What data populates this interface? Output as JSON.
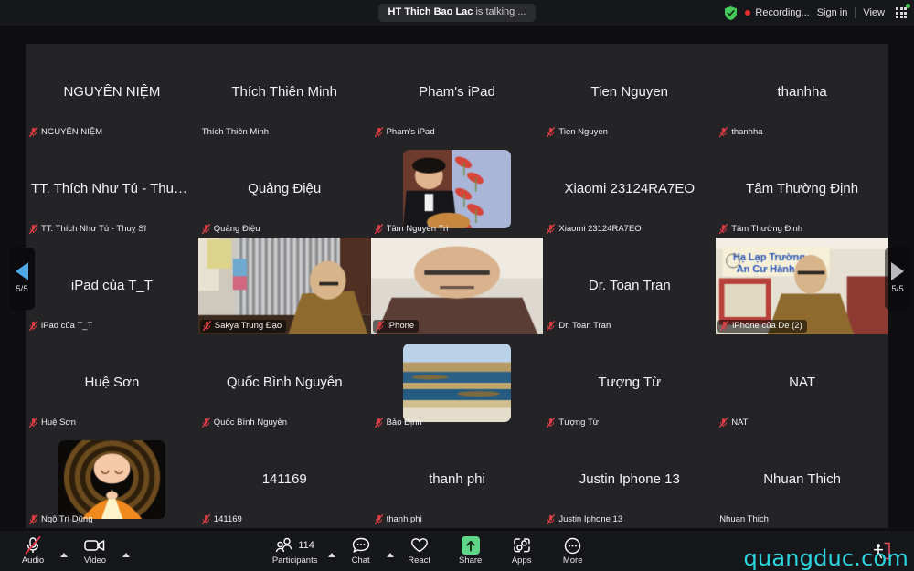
{
  "topbar": {
    "talking_name": "HT Thich Bao Lac",
    "talking_suffix": " is talking ...",
    "shield_icon": "shield-check-icon",
    "recording_label": "Recording...",
    "signin_label": "Sign in",
    "view_label": "View",
    "view_icon": "grid-view-icon",
    "status_dot_color": "#46c95a",
    "recording_dot_color": "#ea2f2f"
  },
  "pagination": {
    "prev_icon": "chevron-left-icon",
    "next_icon": "chevron-right-icon",
    "prev_label": "5/5",
    "next_label": "5/5",
    "prev_color": "#4ea8e8",
    "next_color": "#b9b9bb"
  },
  "gallery": {
    "columns": 5,
    "rows": 5,
    "tiles": [
      {
        "display_name": "NGUYÊN NIỆM",
        "name_label": "NGUYÊN NIỆM",
        "muted": true,
        "video": "none",
        "show_display_name": true
      },
      {
        "display_name": "Thích Thiên Minh",
        "name_label": "Thích Thiên Minh",
        "muted": false,
        "video": "none",
        "show_display_name": true
      },
      {
        "display_name": "Pham's iPad",
        "name_label": "Pham's iPad",
        "muted": true,
        "video": "none",
        "show_display_name": true
      },
      {
        "display_name": "Tien Nguyen",
        "name_label": "Tien Nguyen",
        "muted": true,
        "video": "none",
        "show_display_name": true
      },
      {
        "display_name": "thanhha",
        "name_label": "thanhha",
        "muted": true,
        "video": "none",
        "show_display_name": true
      },
      {
        "display_name": "TT. Thích Như Tú - Thuỵ Sĩ",
        "name_label": "TT. Thích Như Tú - Thuỵ Sĩ",
        "muted": true,
        "video": "none",
        "show_display_name": true
      },
      {
        "display_name": "Quảng Điệu",
        "name_label": "Quảng Điệu",
        "muted": true,
        "video": "none",
        "show_display_name": true
      },
      {
        "display_name": "Tâm Nguyên Trí",
        "name_label": "Tâm Nguyên Trí",
        "muted": true,
        "video": "avatar-man-guitar",
        "show_display_name": false
      },
      {
        "display_name": "Xiaomi 23124RA7EO",
        "name_label": "Xiaomi 23124RA7EO",
        "muted": true,
        "video": "none",
        "show_display_name": true
      },
      {
        "display_name": "Tâm Thường Định",
        "name_label": "Tâm Thường Định",
        "muted": true,
        "video": "none",
        "show_display_name": true
      },
      {
        "display_name": "iPad của T_T",
        "name_label": "iPad của T_T",
        "muted": true,
        "video": "none",
        "show_display_name": true
      },
      {
        "display_name": "Sakya Trung Đạo",
        "name_label": "Sakya Trung Đạo",
        "muted": true,
        "video": "full-room-curtain",
        "show_display_name": false
      },
      {
        "display_name": "iPhone",
        "name_label": "iPhone",
        "muted": true,
        "video": "full-monk-portrait",
        "show_display_name": false
      },
      {
        "display_name": "Dr. Toan Tran",
        "name_label": "Dr. Toan Tran",
        "muted": true,
        "video": "none",
        "show_display_name": true
      },
      {
        "display_name": "iPhone của De (2)",
        "name_label": "iPhone của De (2)",
        "muted": true,
        "video": "full-monk-banner",
        "show_display_name": false
      },
      {
        "display_name": "Huệ Sơn",
        "name_label": "Huệ Sơn",
        "muted": true,
        "video": "none",
        "show_display_name": true
      },
      {
        "display_name": "Quốc Bình Nguyễn",
        "name_label": "Quốc Bình Nguyễn",
        "muted": true,
        "video": "none",
        "show_display_name": true
      },
      {
        "display_name": "Bảo Định",
        "name_label": "Bảo Định",
        "muted": true,
        "video": "avatar-landscape",
        "show_display_name": false
      },
      {
        "display_name": "Tượng Từ",
        "name_label": "Tượng Từ",
        "muted": true,
        "video": "none",
        "show_display_name": true
      },
      {
        "display_name": "NAT",
        "name_label": "NAT",
        "muted": true,
        "video": "none",
        "show_display_name": true
      },
      {
        "display_name": "Ngộ Trí Dũng",
        "name_label": "Ngộ Trí Dũng",
        "muted": true,
        "video": "avatar-monk-cartoon",
        "show_display_name": false
      },
      {
        "display_name": "141169",
        "name_label": "141169",
        "muted": true,
        "video": "none",
        "show_display_name": true
      },
      {
        "display_name": "thanh phi",
        "name_label": "thanh phi",
        "muted": true,
        "video": "none",
        "show_display_name": true
      },
      {
        "display_name": "Justin Iphone 13",
        "name_label": "Justin Iphone 13",
        "muted": true,
        "video": "none",
        "show_display_name": true
      },
      {
        "display_name": "Nhuan Thich",
        "name_label": "Nhuan Thich",
        "muted": false,
        "video": "none",
        "show_display_name": true
      }
    ]
  },
  "toolbar": {
    "audio_label": "Audio",
    "audio_icon": "microphone-muted-icon",
    "audio_caret_icon": "chevron-up-icon",
    "video_label": "Video",
    "video_icon": "camera-icon",
    "video_caret_icon": "chevron-up-icon",
    "participants_label": "Participants",
    "participants_icon": "people-icon",
    "participants_count": "114",
    "participants_caret_icon": "chevron-up-icon",
    "chat_label": "Chat",
    "chat_icon": "chat-bubble-icon",
    "chat_caret_icon": "chevron-up-icon",
    "react_label": "React",
    "react_icon": "heart-icon",
    "share_label": "Share",
    "share_icon": "share-screen-up-arrow-icon",
    "share_accent": "#5fd68a",
    "apps_label": "Apps",
    "apps_icon": "apps-icon",
    "more_label": "More",
    "more_icon": "ellipsis-icon",
    "leave_icon": "leave-door-icon"
  },
  "watermark": {
    "text": "quangduc.com",
    "color": "#2ad6e0"
  }
}
